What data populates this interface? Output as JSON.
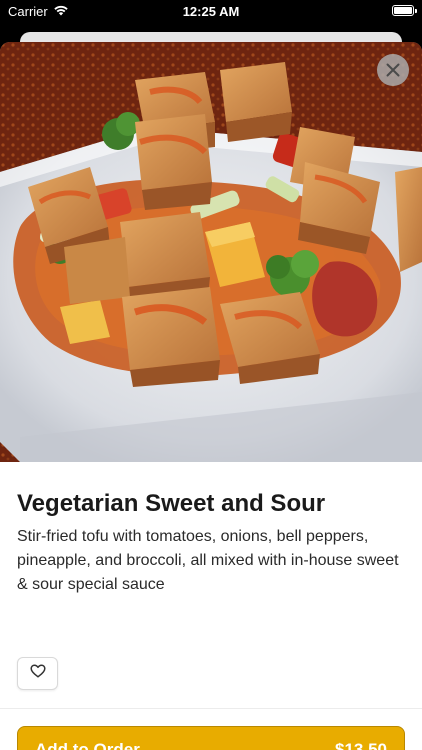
{
  "status_bar": {
    "carrier": "Carrier",
    "time": "12:25 AM"
  },
  "item": {
    "title": "Vegetarian Sweet and Sour",
    "description": "Stir-fried tofu with tomatoes, onions, bell peppers, pineapple, and broccoli, all mixed with in-house sweet & sour special sauce"
  },
  "order_button": {
    "label": "Add to Order",
    "price": "$13.50"
  },
  "icons": {
    "close": "close-icon",
    "favorite": "heart-icon",
    "wifi": "wifi-icon",
    "battery": "battery-icon"
  },
  "colors": {
    "accent": "#e8ac00",
    "accent_border": "#b98800",
    "title_text": "#1a1a1a"
  }
}
